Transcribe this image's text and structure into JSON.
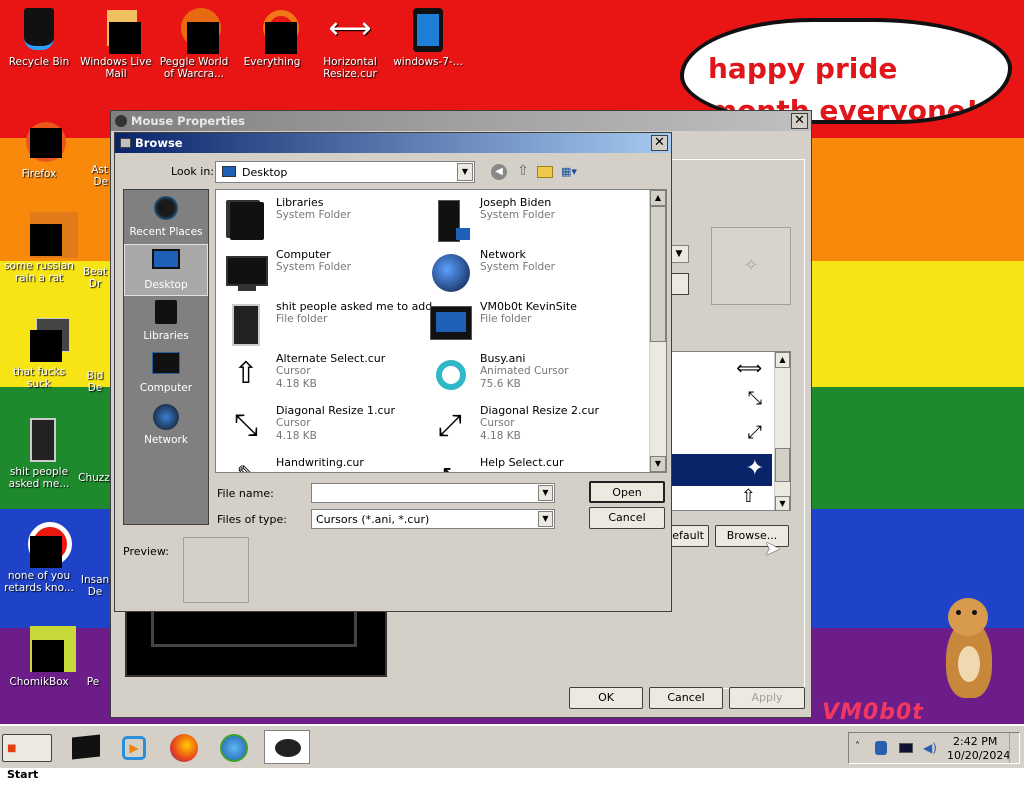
{
  "desktop_icons": [
    {
      "label": "Recycle Bin"
    },
    {
      "label": "Windows Live Mail"
    },
    {
      "label": "Peggle World of Warcra..."
    },
    {
      "label": "Everything"
    },
    {
      "label": "Horizontal Resize.cur"
    },
    {
      "label": "windows-7-..."
    },
    {
      "label": "Firefox"
    },
    {
      "label": "some russian rain a rat"
    },
    {
      "label": "that fucks suck"
    },
    {
      "label": "shit people asked me..."
    },
    {
      "label": "none of you retards kno..."
    },
    {
      "label": "ChomikBox"
    },
    {
      "label": "Ast De"
    },
    {
      "label": "Beat Dr"
    },
    {
      "label": "Bid De"
    },
    {
      "label": "Chuzz"
    },
    {
      "label": "Insan De"
    },
    {
      "label": "Pe"
    }
  ],
  "bubble": {
    "text": "happy pride month everyone!"
  },
  "mouse_props": {
    "title": "Mouse Properties",
    "ok": "OK",
    "cancel": "Cancel",
    "apply": "Apply",
    "browse": "Browse...",
    "use_default": "efault"
  },
  "browse": {
    "title": "Browse",
    "look_in_label": "Look in:",
    "look_in_value": "Desktop",
    "places": [
      {
        "label": "Recent Places"
      },
      {
        "label": "Desktop"
      },
      {
        "label": "Libraries"
      },
      {
        "label": "Computer"
      },
      {
        "label": "Network"
      }
    ],
    "files": [
      {
        "name": "Libraries",
        "type": "System Folder",
        "size": ""
      },
      {
        "name": "Joseph Biden",
        "type": "System Folder",
        "size": ""
      },
      {
        "name": "Computer",
        "type": "System Folder",
        "size": ""
      },
      {
        "name": "Network",
        "type": "System Folder",
        "size": ""
      },
      {
        "name": "shit people asked me to add",
        "type": "File folder",
        "size": ""
      },
      {
        "name": "VM0b0t KevinSite",
        "type": "File folder",
        "size": ""
      },
      {
        "name": "Alternate Select.cur",
        "type": "Cursor",
        "size": "4.18 KB"
      },
      {
        "name": "Busy.ani",
        "type": "Animated Cursor",
        "size": "75.6 KB"
      },
      {
        "name": "Diagonal Resize 1.cur",
        "type": "Cursor",
        "size": "4.18 KB"
      },
      {
        "name": "Diagonal Resize 2.cur",
        "type": "Cursor",
        "size": "4.18 KB"
      },
      {
        "name": "Handwriting.cur",
        "type": "",
        "size": ""
      },
      {
        "name": "Help Select.cur",
        "type": "",
        "size": ""
      }
    ],
    "file_name_label": "File name:",
    "file_name_value": "",
    "files_of_type_label": "Files of type:",
    "files_of_type_value": "Cursors (*.ani, *.cur)",
    "open": "Open",
    "cancel": "Cancel",
    "preview_label": "Preview:"
  },
  "taskbar": {
    "start": "Start",
    "time": "2:42 PM",
    "date": "10/20/2024"
  },
  "watermark": "VM0b0t",
  "colors": {
    "titlebar_start": "#0a246a",
    "titlebar_end": "#a6caf0",
    "selection": "#0a246a"
  }
}
